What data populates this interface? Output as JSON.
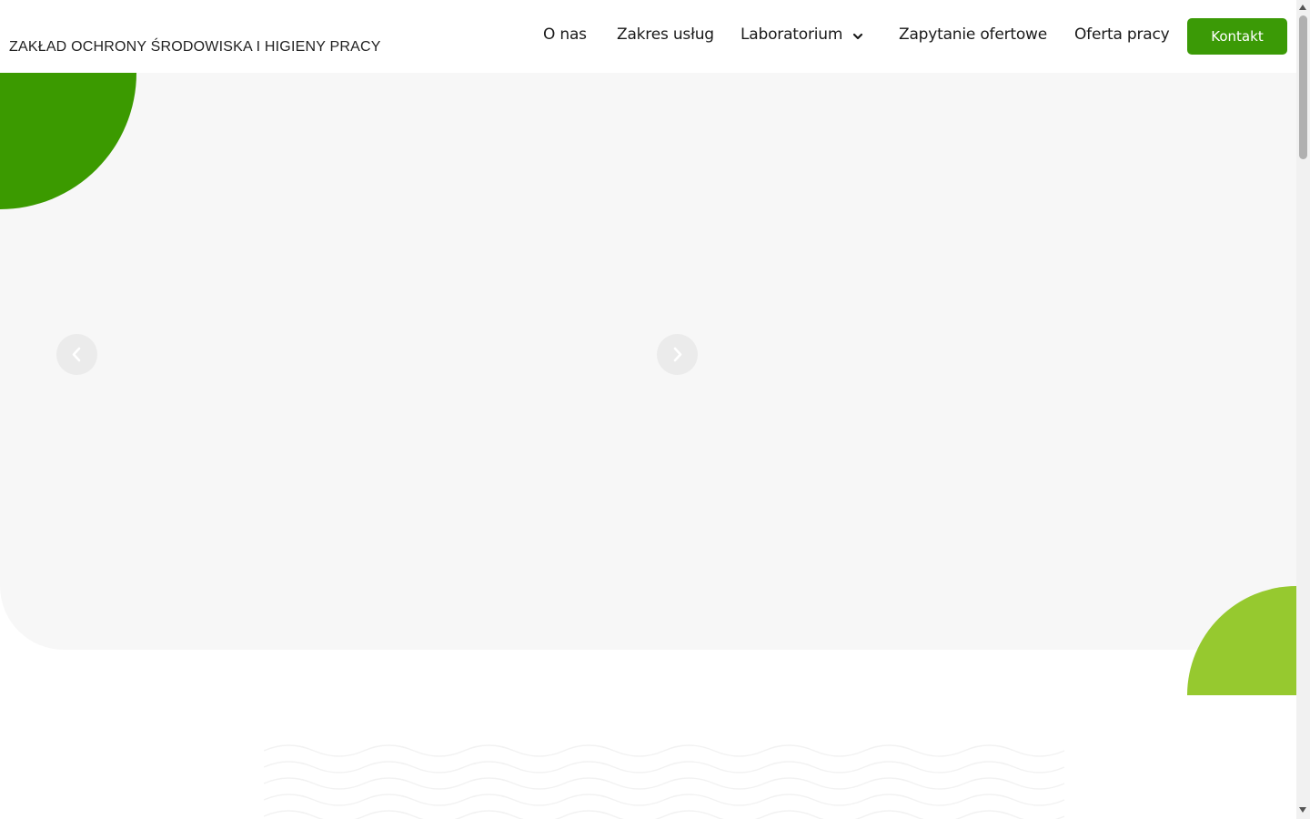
{
  "header": {
    "brand": "ZAKŁAD OCHRONY ŚRODOWISKA I HIGIENY PRACY",
    "nav": {
      "items": [
        {
          "label": "O nas"
        },
        {
          "label": "Zakres usług"
        },
        {
          "label": "Laboratorium",
          "icon": "chevron-down-icon"
        },
        {
          "label": "Zapytanie ofertowe"
        },
        {
          "label": "Oferta pracy"
        }
      ]
    },
    "contact_label": "Kontakt"
  },
  "hero": {
    "prev_icon": "chevron-left-icon",
    "next_icon": "chevron-right-icon"
  },
  "colors": {
    "brand_green": "#3b9a06",
    "accent_lime": "#96c92f",
    "hero_background": "#f7f7f7",
    "text": "#1a1a1a"
  }
}
